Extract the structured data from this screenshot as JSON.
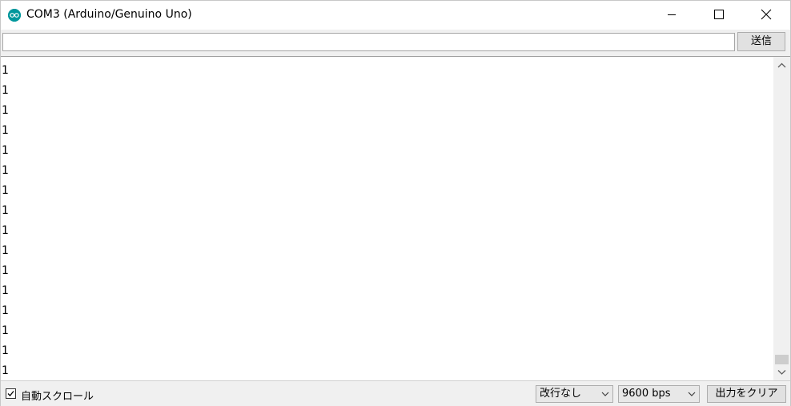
{
  "window": {
    "title": "COM3 (Arduino/Genuino Uno)"
  },
  "send_row": {
    "input_value": "",
    "send_label": "送信"
  },
  "output": {
    "lines": [
      "1",
      "1",
      "1",
      "1",
      "1",
      "1",
      "1",
      "1",
      "1",
      "1",
      "1",
      "1",
      "1",
      "1",
      "1",
      "1"
    ]
  },
  "bottom": {
    "autoscroll_label": "自動スクロール",
    "autoscroll_checked": true,
    "line_ending_selected": "改行なし",
    "baud_selected": "9600 bps",
    "clear_label": "出力をクリア"
  },
  "colors": {
    "app_icon": "#00979c",
    "background": "#f0f0f0"
  },
  "icons": {
    "app": "arduino-logo-icon",
    "minimize": "minimize-icon",
    "maximize": "maximize-icon",
    "close": "close-icon",
    "scroll_up": "chevron-up-icon",
    "scroll_down": "chevron-down-icon",
    "dropdown": "chevron-down-icon",
    "check": "check-icon"
  }
}
